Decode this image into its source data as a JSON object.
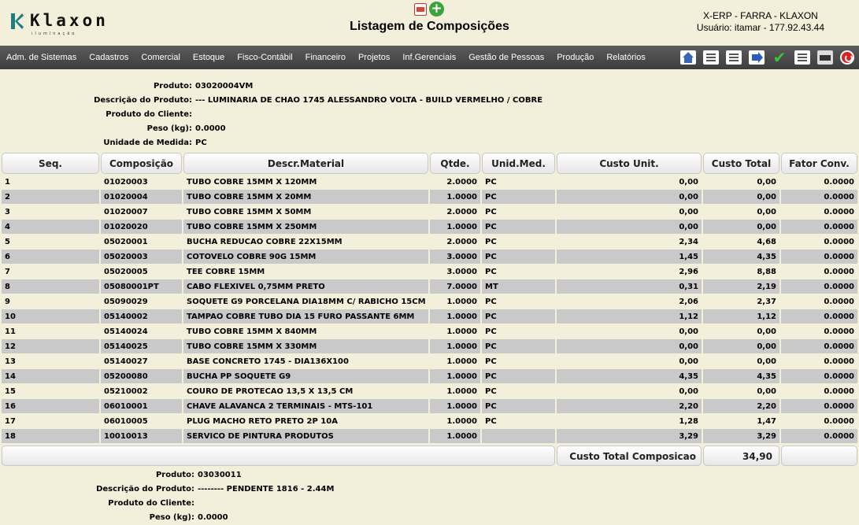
{
  "header": {
    "logo_text": "Klaxon",
    "logo_tagline": "iluminação",
    "title": "Listagem de Composições",
    "system_name": "X-ERP - FARRA - KLAXON",
    "user_info": "Usuário: itamar - 177.92.43.44"
  },
  "menu": [
    "Adm. de Sistemas",
    "Cadastros",
    "Comercial",
    "Estoque",
    "Fisco-Contábil",
    "Financeiro",
    "Projetos",
    "Inf.Gerenciais",
    "Gestão de Pessoas",
    "Produção",
    "Relatórios"
  ],
  "toolbar_icons": [
    "home-icon",
    "edit-document-icon",
    "view-document-icon",
    "forward-arrow-icon",
    "check-icon",
    "new-document-icon",
    "print-icon",
    "exit-icon"
  ],
  "product1": {
    "labels": {
      "produto": "Produto:",
      "descricao": "Descrição do Produto:",
      "cliente": "Produto do Cliente:",
      "peso": "Peso (kg):",
      "unidade": "Unidade de Medida:"
    },
    "values": {
      "produto": "03020004VM",
      "descricao": "--- LUMINARIA DE CHAO 1745 ALESSANDRO VOLTA - BUILD VERMELHO / COBRE",
      "cliente": "",
      "peso": "0.0000",
      "unidade": "PC"
    }
  },
  "table": {
    "columns": [
      "Seq.",
      "Composição",
      "Descr.Material",
      "Qtde.",
      "Unid.Med.",
      "Custo Unit.",
      "Custo Total",
      "Fator Conv."
    ],
    "rows": [
      [
        "1",
        "01020003",
        "TUBO COBRE 15MM X 120MM",
        "2.0000",
        "PC",
        "0,00",
        "0,00",
        "0.0000"
      ],
      [
        "2",
        "01020004",
        "TUBO COBRE 15MM X 20MM",
        "1.0000",
        "PC",
        "0,00",
        "0,00",
        "0.0000"
      ],
      [
        "3",
        "01020007",
        "TUBO COBRE 15MM X 50MM",
        "2.0000",
        "PC",
        "0,00",
        "0,00",
        "0.0000"
      ],
      [
        "4",
        "01020020",
        "TUBO COBRE 15MM X 250MM",
        "1.0000",
        "PC",
        "0,00",
        "0,00",
        "0.0000"
      ],
      [
        "5",
        "05020001",
        "BUCHA REDUCAO COBRE 22X15MM",
        "2.0000",
        "PC",
        "2,34",
        "4,68",
        "0.0000"
      ],
      [
        "6",
        "05020003",
        "COTOVELO COBRE 90G 15MM",
        "3.0000",
        "PC",
        "1,45",
        "4,35",
        "0.0000"
      ],
      [
        "7",
        "05020005",
        "TEE COBRE 15MM",
        "3.0000",
        "PC",
        "2,96",
        "8,88",
        "0.0000"
      ],
      [
        "8",
        "05080001PT",
        "CABO FLEXIVEL 0,75MM PRETO",
        "7.0000",
        "MT",
        "0,31",
        "2,19",
        "0.0000"
      ],
      [
        "9",
        "05090029",
        "SOQUETE G9 PORCELANA DIA18MM C/ RABICHO 15CM",
        "1.0000",
        "PC",
        "2,06",
        "2,37",
        "0.0000"
      ],
      [
        "10",
        "05140002",
        "TAMPAO COBRE TUBO DIA 15 FURO PASSANTE 6MM",
        "1.0000",
        "PC",
        "1,12",
        "1,12",
        "0.0000"
      ],
      [
        "11",
        "05140024",
        "TUBO COBRE 15MM X 840MM",
        "1.0000",
        "PC",
        "0,00",
        "0,00",
        "0.0000"
      ],
      [
        "12",
        "05140025",
        "TUBO COBRE 15MM X 330MM",
        "1.0000",
        "PC",
        "0,00",
        "0,00",
        "0.0000"
      ],
      [
        "13",
        "05140027",
        "BASE CONCRETO 1745 - DIA136X100",
        "1.0000",
        "PC",
        "0,00",
        "0,00",
        "0.0000"
      ],
      [
        "14",
        "05200080",
        "BUCHA PP SOQUETE G9",
        "1.0000",
        "PC",
        "4,35",
        "4,35",
        "0.0000"
      ],
      [
        "15",
        "05210002",
        "COURO DE PROTECAO 13,5 X 13,5 CM",
        "1.0000",
        "PC",
        "0,00",
        "0,00",
        "0.0000"
      ],
      [
        "16",
        "06010001",
        "CHAVE ALAVANCA 2 TERMINAIS - MTS-101",
        "1.0000",
        "PC",
        "2,20",
        "2,20",
        "0.0000"
      ],
      [
        "17",
        "06010005",
        "PLUG MACHO RETO PRETO 2P 10A",
        "1.0000",
        "PC",
        "1,28",
        "1,47",
        "0.0000"
      ],
      [
        "18",
        "10010013",
        "SERVICO DE PINTURA PRODUTOS",
        "1.0000",
        "",
        "3,29",
        "3,29",
        "0.0000"
      ]
    ],
    "footer_label": "Custo Total Composicao",
    "footer_total": "34,90"
  },
  "product2": {
    "labels": {
      "produto": "Produto:",
      "descricao": "Descrição do Produto:",
      "cliente": "Produto do Cliente:",
      "peso": "Peso (kg):"
    },
    "values": {
      "produto": "03030011",
      "descricao": "-------- PENDENTE 1816 - 2.44M",
      "cliente": "",
      "peso": "0.0000"
    }
  }
}
